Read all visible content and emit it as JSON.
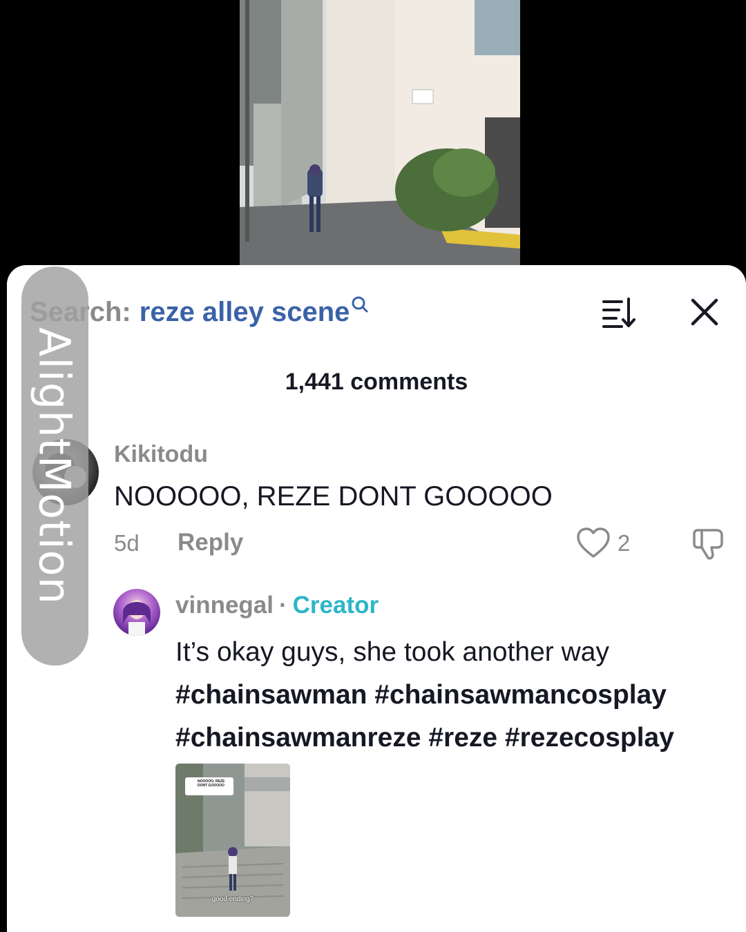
{
  "search": {
    "prefix": "Search:",
    "query": "reze alley scene"
  },
  "comments_header": {
    "count_label": "1,441 comments"
  },
  "comments": [
    {
      "username": "Kikitodu",
      "text": "NOOOOO, REZE DONT GOOOOO",
      "age": "5d",
      "reply_label": "Reply",
      "likes": "2"
    },
    {
      "username": "vinnegal",
      "separator": "·",
      "badge": "Creator",
      "text_lines": [
        " It’s okay guys, she took another way",
        "#chainsawman #chainsawmancosplay",
        "#chainsawmanreze #reze #rezecosplay"
      ],
      "attachment": {
        "overlay_text": "NOOOOO, REZE DONT GOOOOO",
        "caption": "good ending?"
      }
    }
  ],
  "watermark": {
    "text": "AlightMotion"
  },
  "icons": {
    "search_query": "magnifier-icon",
    "sort": "sort-descending-icon",
    "close": "close-x-icon",
    "like": "heart-outline-icon",
    "dislike": "thumbs-down-icon"
  },
  "colors": {
    "sheet_background": "#ffffff",
    "query_blue": "#3a62a8",
    "creator_teal": "#2bb6c8",
    "muted_gray": "#8a8a8a",
    "text_dark": "#161823"
  }
}
